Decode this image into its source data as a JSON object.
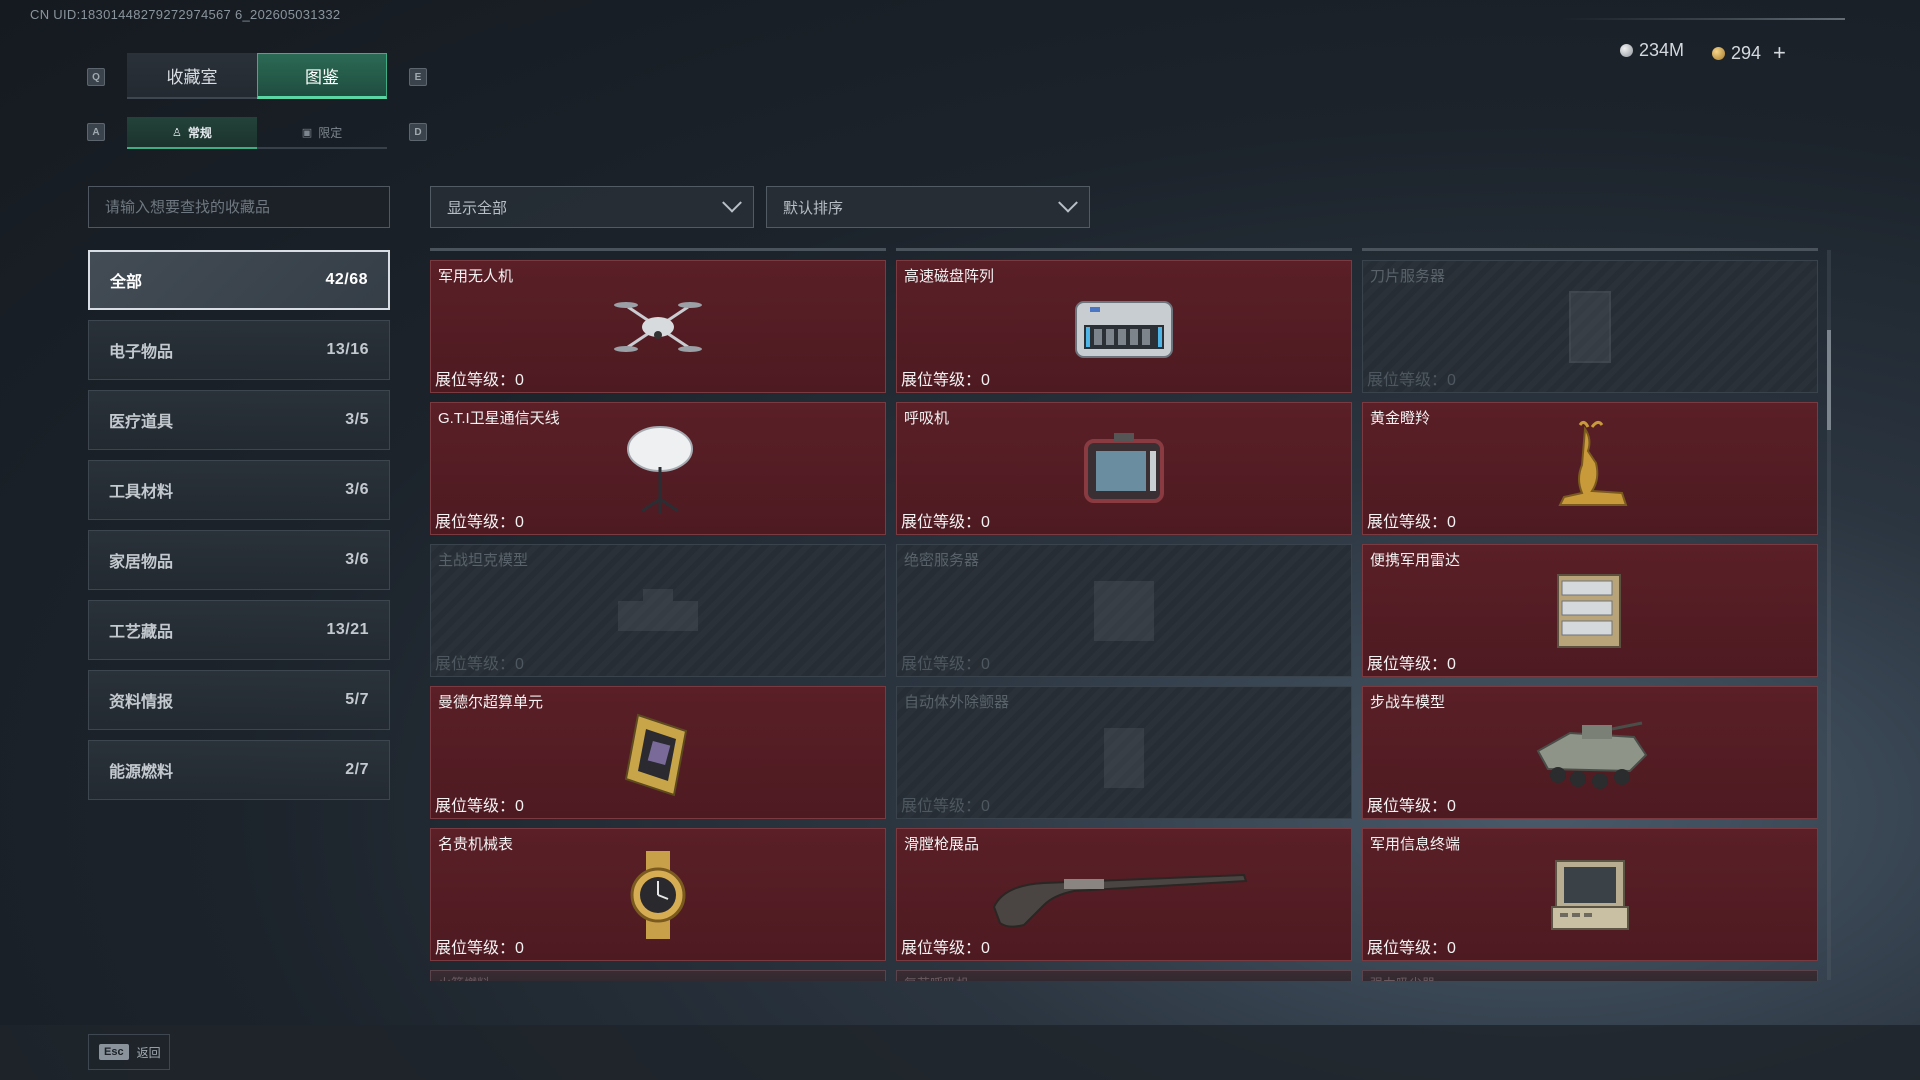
{
  "uid": "CN UID:18301448279272974567 6_202605031332",
  "keys": {
    "q": "Q",
    "e": "E",
    "a": "A",
    "d": "D"
  },
  "main_tabs": [
    {
      "label": "收藏室",
      "active": false
    },
    {
      "label": "图鉴",
      "active": true
    }
  ],
  "sub_tabs": [
    {
      "label": "常规",
      "icon": "figure-icon",
      "active": true
    },
    {
      "label": "限定",
      "icon": "image-icon",
      "active": false
    }
  ],
  "currency": {
    "silver": "234M",
    "gold": "294"
  },
  "search": {
    "placeholder": "请输入想要查找的收藏品"
  },
  "filter": {
    "show": "显示全部",
    "sort": "默认排序"
  },
  "categories": [
    {
      "label": "全部",
      "count": "42/68",
      "active": true
    },
    {
      "label": "电子物品",
      "count": "13/16"
    },
    {
      "label": "医疗道具",
      "count": "3/5"
    },
    {
      "label": "工具材料",
      "count": "3/6"
    },
    {
      "label": "家居物品",
      "count": "3/6"
    },
    {
      "label": "工艺藏品",
      "count": "13/21"
    },
    {
      "label": "资料情报",
      "count": "5/7"
    },
    {
      "label": "能源燃料",
      "count": "2/7"
    }
  ],
  "level_label": "展位等级：",
  "items": [
    {
      "name": "军用无人机",
      "level": "0",
      "locked": false,
      "icon": "drone-icon"
    },
    {
      "name": "高速磁盘阵列",
      "level": "0",
      "locked": false,
      "icon": "disk-array-icon"
    },
    {
      "name": "刀片服务器",
      "level": "0",
      "locked": true,
      "icon": "blade-server-icon"
    },
    {
      "name": "G.T.I卫星通信天线",
      "level": "0",
      "locked": false,
      "icon": "satellite-dish-icon"
    },
    {
      "name": "呼吸机",
      "level": "0",
      "locked": false,
      "icon": "ventilator-icon"
    },
    {
      "name": "黄金瞪羚",
      "level": "0",
      "locked": false,
      "icon": "gold-gazelle-icon"
    },
    {
      "name": "主战坦克模型",
      "level": "0",
      "locked": true,
      "icon": "tank-model-icon"
    },
    {
      "name": "绝密服务器",
      "level": "0",
      "locked": true,
      "icon": "secret-server-icon"
    },
    {
      "name": "便携军用雷达",
      "level": "0",
      "locked": false,
      "icon": "radar-icon"
    },
    {
      "name": "曼德尔超算单元",
      "level": "0",
      "locked": false,
      "icon": "supercomputer-unit-icon"
    },
    {
      "name": "自动体外除颤器",
      "level": "0",
      "locked": true,
      "icon": "defibrillator-icon"
    },
    {
      "name": "步战车模型",
      "level": "0",
      "locked": false,
      "icon": "ifv-model-icon"
    },
    {
      "name": "名贵机械表",
      "level": "0",
      "locked": false,
      "icon": "watch-icon"
    },
    {
      "name": "滑膛枪展品",
      "level": "0",
      "locked": false,
      "icon": "musket-icon"
    },
    {
      "name": "军用信息终端",
      "level": "0",
      "locked": false,
      "icon": "terminal-icon"
    }
  ],
  "partial_items": [
    "火箭燃料",
    "复苏呼吸机",
    "强力吸尘器"
  ],
  "footer": {
    "esc_key": "Esc",
    "esc_label": "返回"
  }
}
